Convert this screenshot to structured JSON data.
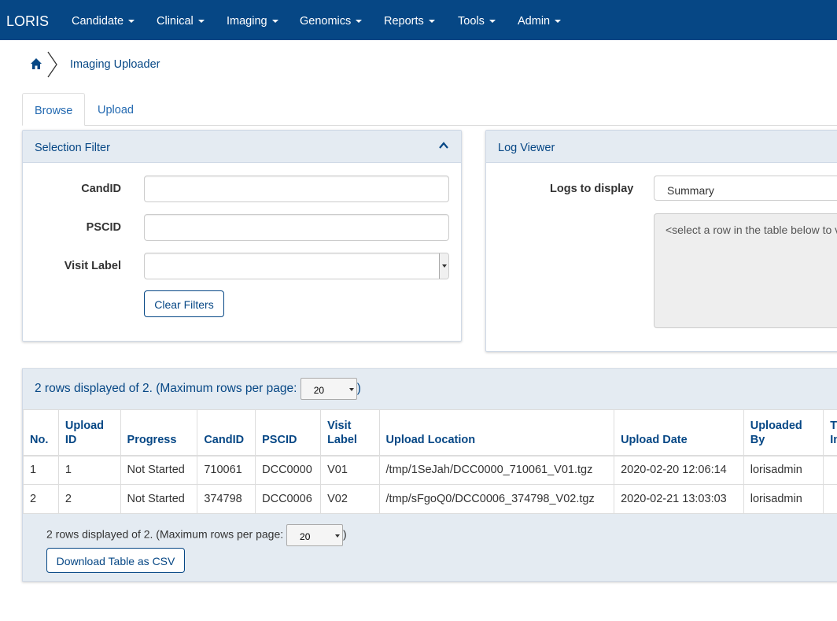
{
  "navbar": {
    "brand": "LORIS",
    "menus": [
      "Candidate",
      "Clinical",
      "Imaging",
      "Genomics",
      "Reports",
      "Tools",
      "Admin"
    ]
  },
  "breadcrumb": {
    "current": "Imaging Uploader"
  },
  "tabs": [
    "Browse",
    "Upload"
  ],
  "filter": {
    "title": "Selection Filter",
    "fields": {
      "candid": "CandID",
      "pscid": "PSCID",
      "visit_label": "Visit Label"
    },
    "values": {
      "candid": "",
      "pscid": "",
      "visit_label": ""
    },
    "clear_button": "Clear Filters"
  },
  "log_viewer": {
    "title": "Log Viewer",
    "logs_label": "Logs to display",
    "logs_value": "Summary",
    "placeholder": "<select a row in the table below to v"
  },
  "table": {
    "rows_info_prefix": "2 rows displayed of 2. (Maximum rows per page:",
    "rows_info_suffix": ")",
    "rows_per_page": "20",
    "columns": [
      "No.",
      "Upload ID",
      "Progress",
      "CandID",
      "PSCID",
      "Visit Label",
      "Upload Location",
      "Upload Date",
      "Uploaded By",
      "T In"
    ],
    "rows": [
      [
        "1",
        "1",
        "Not Started",
        "710061",
        "DCC0000",
        "V01",
        "/tmp/1SeJah/DCC0000_710061_V01.tgz",
        "2020-02-20 12:06:14",
        "lorisadmin",
        ""
      ],
      [
        "2",
        "2",
        "Not Started",
        "374798",
        "DCC0006",
        "V02",
        "/tmp/sFgoQ0/DCC0006_374798_V02.tgz",
        "2020-02-21 13:03:03",
        "lorisadmin",
        ""
      ]
    ],
    "download_button": "Download Table as CSV"
  }
}
